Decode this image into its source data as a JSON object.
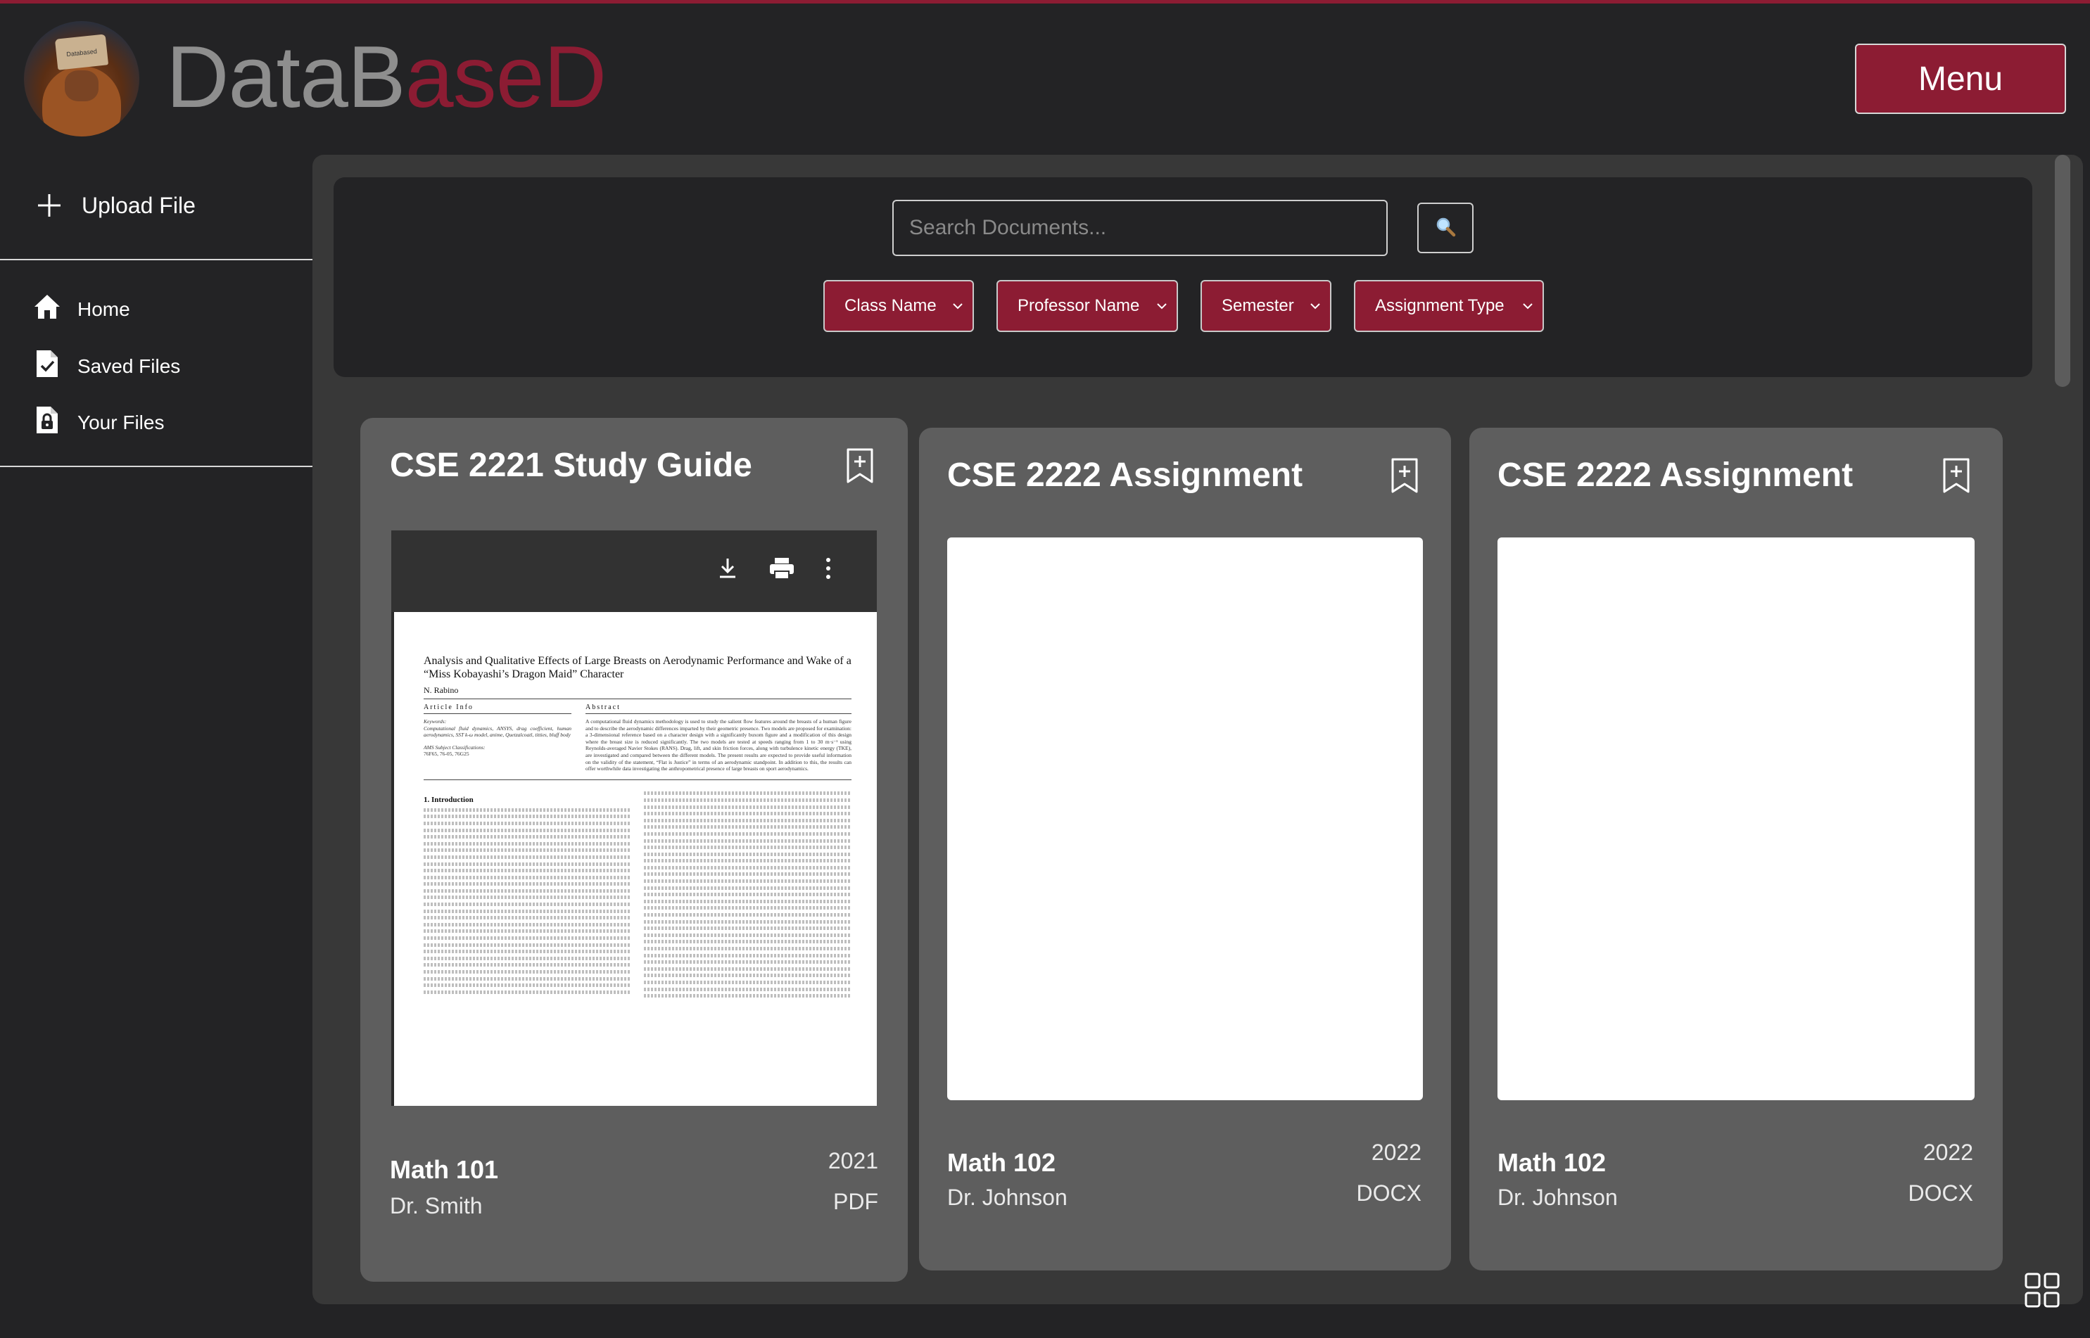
{
  "app": {
    "brand_part1": "DataB",
    "brand_part2": "aseD",
    "avatar_hat_text": "Databased",
    "menu_label": "Menu",
    "accent_color": "#8c1c33",
    "background_color": "#232325"
  },
  "sidebar": {
    "upload_label": "Upload File",
    "items": [
      {
        "label": "Home",
        "icon": "home-icon"
      },
      {
        "label": "Saved Files",
        "icon": "file-check-icon"
      },
      {
        "label": "Your Files",
        "icon": "file-lock-icon"
      }
    ]
  },
  "search": {
    "placeholder": "Search Documents...",
    "button_icon": "magnifier-icon",
    "filters": [
      "Class Name",
      "Professor Name",
      "Semester",
      "Assignment Type"
    ]
  },
  "cards": [
    {
      "title": "CSE 2221 Study Guide",
      "class": "Math 101",
      "professor": "Dr. Smith",
      "year": "2021",
      "type": "PDF",
      "preview": {
        "kind": "pdf",
        "toolbar_icons": [
          "download-icon",
          "print-icon",
          "more-vertical-icon"
        ],
        "doc_title": "Analysis and Qualitative Effects of Large Breasts on Aerodynamic Performance and Wake of a “Miss Kobayashi’s Dragon Maid” Character",
        "doc_author": "N. Rabino",
        "article_info_label": "Article Info",
        "abstract_label": "Abstract",
        "keywords_label": "Keywords:",
        "keywords": "Computational fluid dynamics, ANSYS, drag coefficient, human aerodynamics, SST k-ω model, anime, Quetzalcoatl, titties, bluff body",
        "ams_label": "AMS Subject Classifications:",
        "ams": "76F65, 76-05, 76G25",
        "abstract_text": "A computational fluid dynamics methodology is used to study the salient flow features around the breasts of a human figure and to describe the aerodynamic differences imparted by their geometric presence. Two models are proposed for examination: a 3-dimensional reference based on a character design with a significantly buxom figure and a modification of this design where the breast size is reduced significantly. The two models are tested at speeds ranging from 1 to 30 m·s⁻¹ using Reynolds-averaged Navier Stokes (RANS). Drag, lift, and skin friction forces, along with turbulence kinetic energy (TKE), are investigated and compared between the different models. The present results are expected to provide useful information on the validity of the statement, “Flat is Justice” in terms of an aerodynamic standpoint. In addition to this, the results can offer worthwhile data investigating the anthropometrical presence of large breasts on sport aerodynamics.",
        "section_heading": "1.   Introduction"
      }
    },
    {
      "title": "CSE 2222 Assignment",
      "class": "Math 102",
      "professor": "Dr. Johnson",
      "year": "2022",
      "type": "DOCX",
      "preview": {
        "kind": "blank"
      }
    },
    {
      "title": "CSE 2222 Assignment",
      "class": "Math 102",
      "professor": "Dr. Johnson",
      "year": "2022",
      "type": "DOCX",
      "preview": {
        "kind": "blank"
      }
    }
  ],
  "footer": {
    "view_toggle_icon": "grid-view-icon"
  }
}
